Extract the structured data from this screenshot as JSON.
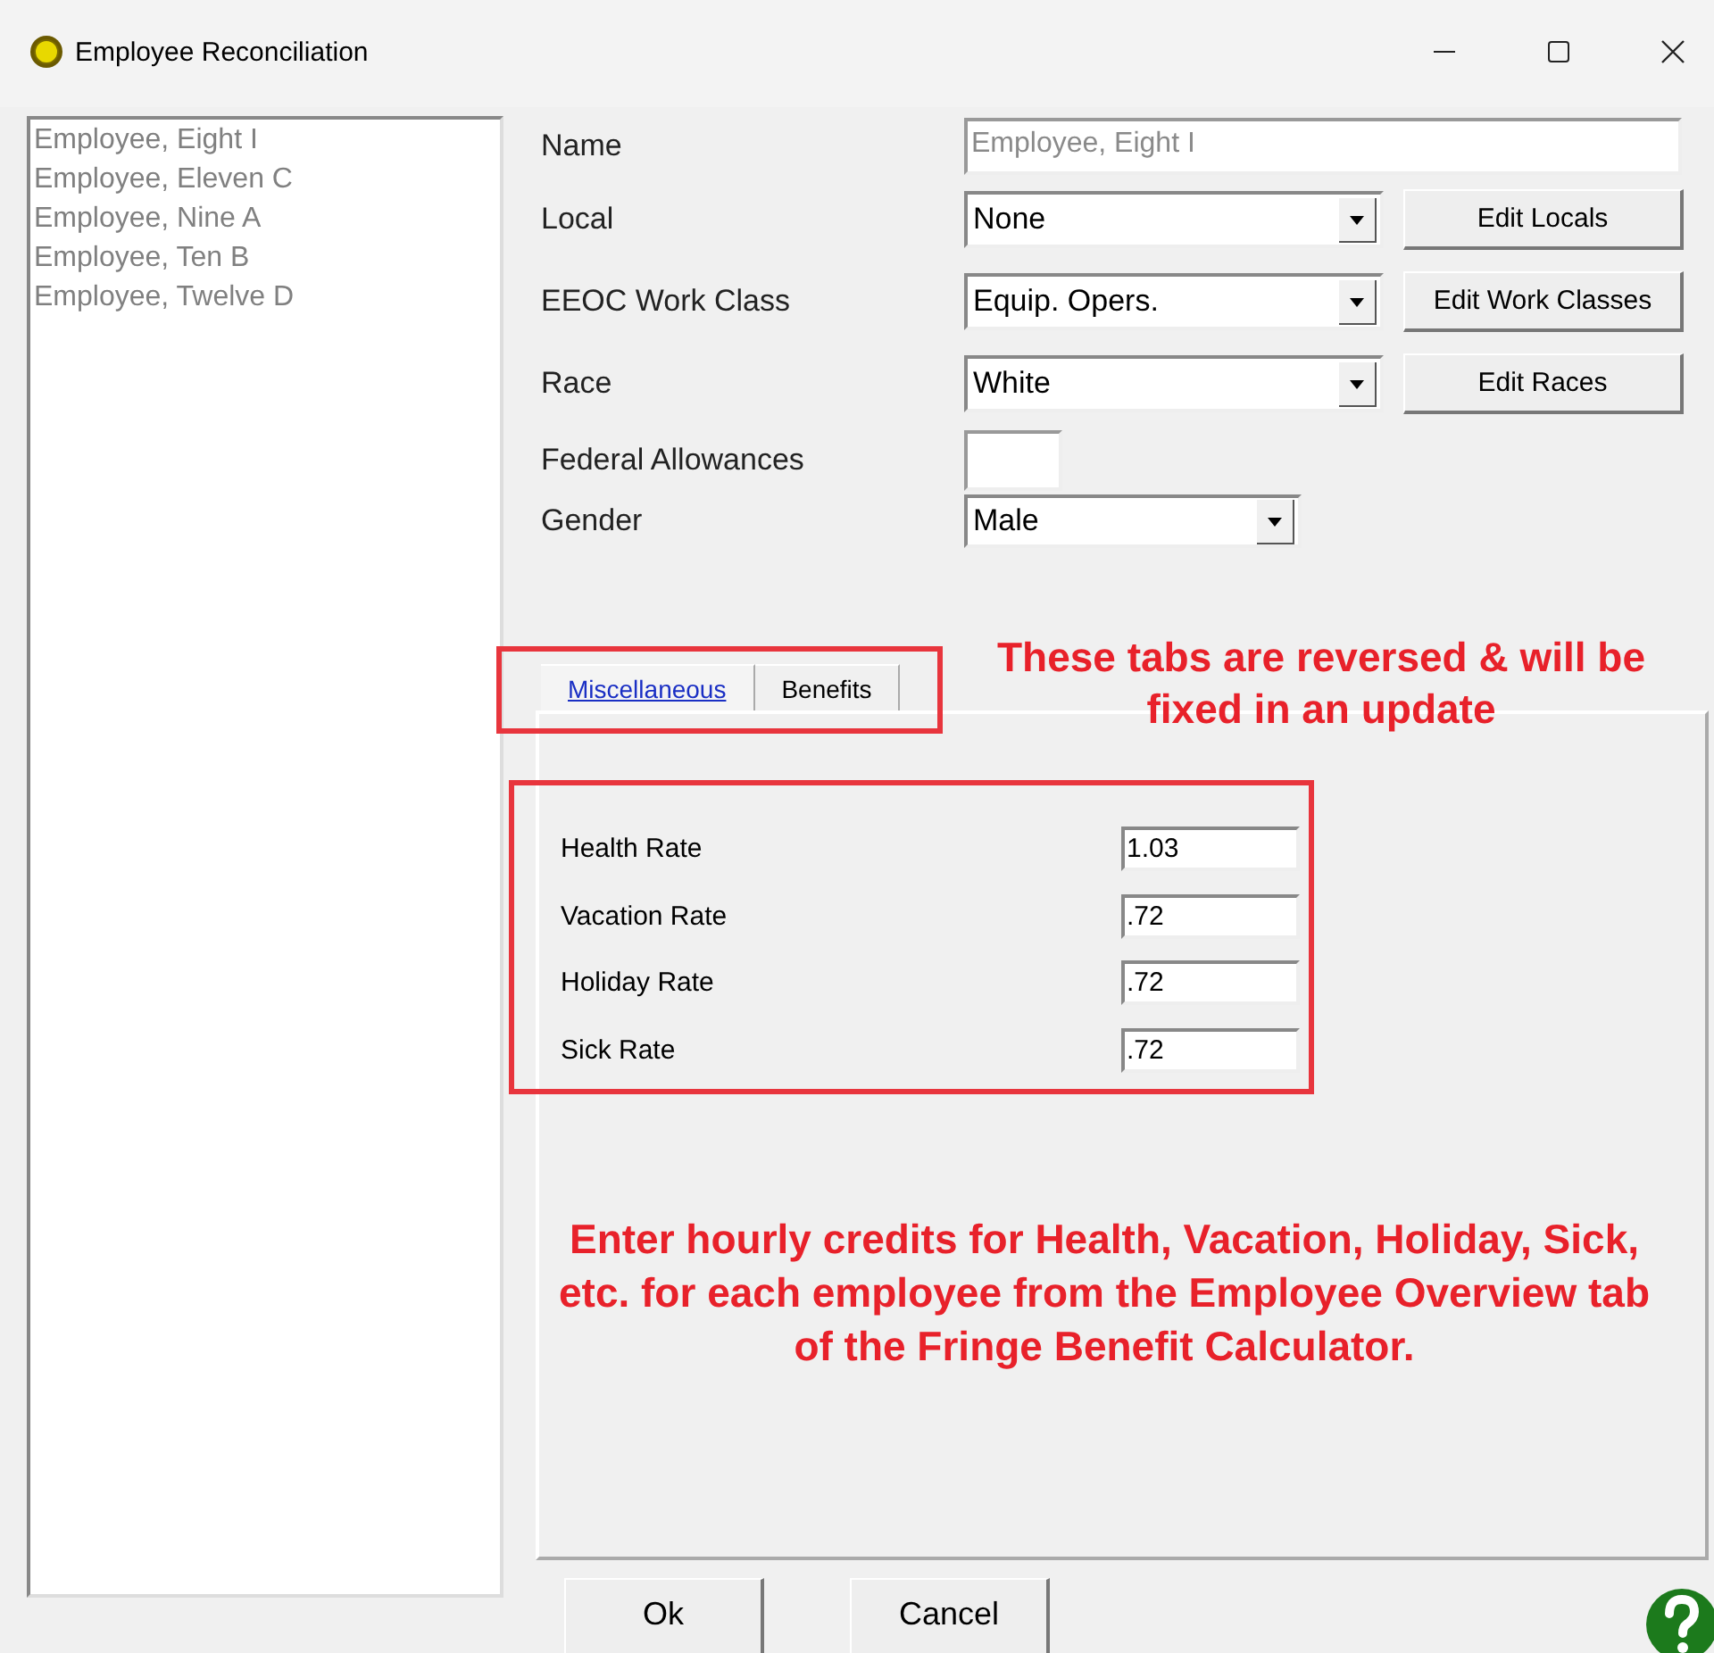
{
  "window": {
    "title": "Employee Reconciliation"
  },
  "employees": [
    "Employee, Eight I",
    "Employee, Eleven C",
    "Employee, Nine A",
    "Employee, Ten B",
    "Employee, Twelve D"
  ],
  "fields": [
    {
      "kind": "text",
      "label": "Name",
      "value": "Employee, Eight I",
      "disabled": true
    },
    {
      "kind": "combo",
      "label": "Local",
      "value": "None",
      "button": "Edit Locals"
    },
    {
      "kind": "combo",
      "label": "EEOC Work Class",
      "value": "Equip. Opers.",
      "button": "Edit Work Classes"
    },
    {
      "kind": "combo",
      "label": "Race",
      "value": "White",
      "button": "Edit Races"
    },
    {
      "kind": "small",
      "label": "Federal Allowances"
    },
    {
      "kind": "short-combo",
      "label": "Gender",
      "value": "Male"
    }
  ],
  "tabs": [
    {
      "label": "Miscellaneous",
      "selected": true
    },
    {
      "label": "Benefits",
      "selected": false
    }
  ],
  "rates": [
    {
      "label": "Health Rate",
      "value": "1.03"
    },
    {
      "label": "Vacation Rate",
      "value": ".72"
    },
    {
      "label": "Holiday Rate",
      "value": ".72"
    },
    {
      "label": "Sick Rate",
      "value": ".72"
    }
  ],
  "annotations": [
    "These tabs are reversed & will be fixed in an update",
    "Enter hourly credits for Health, Vacation, Holiday, Sick, etc. for each employee from the Employee Overview tab of the Fringe Benefit Calculator."
  ],
  "buttons": [
    "Ok",
    "Cancel"
  ]
}
